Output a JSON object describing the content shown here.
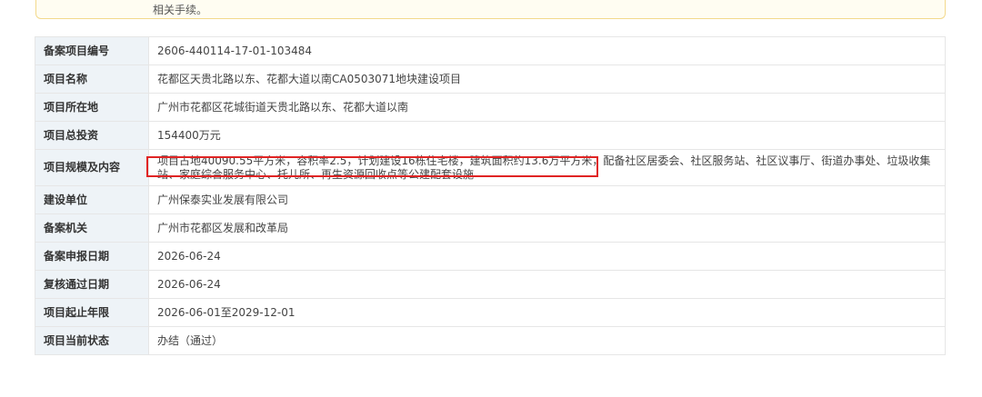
{
  "notice": {
    "text": "相关手续。"
  },
  "rows": [
    {
      "label": "备案项目编号",
      "value": "2606-440114-17-01-103484"
    },
    {
      "label": "项目名称",
      "value": "花都区天贵北路以东、花都大道以南CA0503071地块建设项目"
    },
    {
      "label": "项目所在地",
      "value": "广州市花都区花城街道天贵北路以东、花都大道以南"
    },
    {
      "label": "项目总投资",
      "value": "154400万元"
    },
    {
      "label": "项目规模及内容",
      "value": "项目占地40090.55平方米，容积率2.5，计划建设16栋住宅楼，建筑面积约13.6万平方米，配备社区居委会、社区服务站、社区议事厅、街道办事处、垃圾收集站、家庭综合服务中心、托儿所、再生资源回收点等公建配套设施"
    },
    {
      "label": "建设单位",
      "value": "广州保泰实业发展有限公司"
    },
    {
      "label": "备案机关",
      "value": "广州市花都区发展和改革局"
    },
    {
      "label": "备案申报日期",
      "value": "2026-06-24"
    },
    {
      "label": "复核通过日期",
      "value": "2026-06-24"
    },
    {
      "label": "项目起止年限",
      "value": "2026-06-01至2029-12-01"
    },
    {
      "label": "项目当前状态",
      "value": "办结（通过）"
    }
  ],
  "colors": {
    "label_bg": "#eef3f7",
    "border": "#e6e6e6",
    "highlight": "#e02424",
    "notice_border": "#f3d98c"
  }
}
